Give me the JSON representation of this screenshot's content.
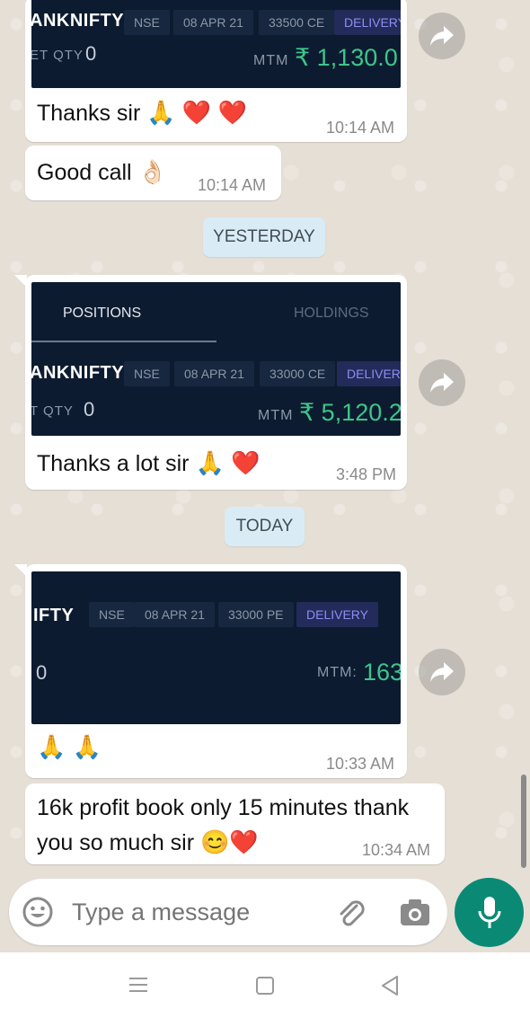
{
  "messages": [
    {
      "type": "image-reply",
      "card": {
        "symbol": "ANKNIFTY",
        "chips": [
          "NSE",
          "08 APR 21",
          "33500 CE",
          "DELIVERY"
        ],
        "qty_label": "ET QTY",
        "qty_value": "0",
        "mtm_label": "MTM",
        "mtm_value": "₹ 1,130.0"
      },
      "text": "Thanks sir",
      "emoji": "🙏 ❤️ ❤️",
      "time": "10:14 AM"
    },
    {
      "type": "text",
      "text": "Good call",
      "emoji": "👌🏻",
      "time": "10:14 AM"
    },
    {
      "type": "image-reply",
      "card": {
        "tabs": [
          "POSITIONS",
          "HOLDINGS"
        ],
        "symbol": "ANKNIFTY",
        "chips": [
          "NSE",
          "08 APR 21",
          "33000 CE",
          "DELIVERY"
        ],
        "qty_label": "T QTY",
        "qty_value": "0",
        "mtm_label": "MTM",
        "mtm_value": "₹ 5,120.2"
      },
      "text": "Thanks a lot sir",
      "emoji": "🙏 ❤️",
      "time": "3:48 PM"
    },
    {
      "type": "image-reply",
      "card": {
        "symbol": "IFTY",
        "chips": [
          "NSE",
          "08 APR 21",
          "33000 PE",
          "DELIVERY"
        ],
        "qty_value": "0",
        "mtm_label": "MTM:",
        "mtm_value": "163"
      },
      "emoji": "🙏 🙏",
      "time": "10:33 AM"
    },
    {
      "type": "text",
      "text_line1": "16k profit book only 15 minutes thank",
      "text_line2": "you so much sir",
      "emoji": "😊❤️",
      "time": "10:34 AM"
    }
  ],
  "date_separators": [
    "YESTERDAY",
    "TODAY"
  ],
  "composer": {
    "placeholder": "Type a message",
    "emoji_icon": "emoji-icon",
    "attach_icon": "paperclip-icon",
    "camera_icon": "camera-icon",
    "mic_icon": "mic-icon"
  },
  "colors": {
    "accent": "#0a8a74",
    "card_bg": "#0d1b30",
    "profit_green": "#3cc68a",
    "date_chip": "#d9ecf6"
  }
}
